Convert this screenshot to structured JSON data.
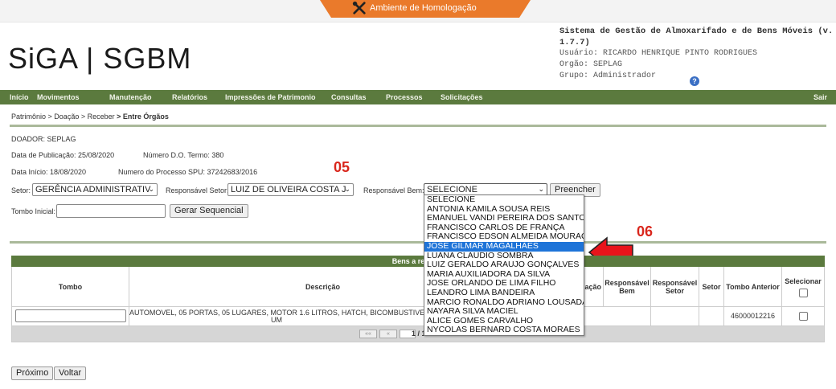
{
  "env_banner": {
    "label": "Ambiente de Homologação",
    "icon": "tools-icon",
    "color": "#ea7a2b"
  },
  "logo": {
    "text": "SiGA | SGBM"
  },
  "system": {
    "title": "Sistema de Gestão de Almoxarifado e de Bens Móveis (v. 1.7.7)",
    "user": "Usuário: RICARDO HENRIQUE PINTO RODRIGUES",
    "org": "Orgão: SEPLAG",
    "group": "Grupo: Administrador",
    "help_icon": "?"
  },
  "menu": {
    "items": [
      "Início",
      "Movimentos",
      "Manutenção",
      "Relatórios",
      "Impressões de Patrimonio",
      "Consultas",
      "Processos",
      "Solicitações"
    ],
    "logout": "Sair",
    "color": "#5b7a3e"
  },
  "breadcrumb": {
    "parts": [
      "Patrimônio",
      "> Doação",
      "> Receber",
      "> Entre Órgãos"
    ]
  },
  "info": {
    "donor": "DOADOR: SEPLAG",
    "pub_date": "Data de Publicação: 25/08/2020",
    "do_term": "Número D.O. Termo: 380",
    "start_date": "Data Início: 18/08/2020",
    "process": "Numero do Processo SPU: 37242683/2016"
  },
  "annotations": {
    "step_a": "05",
    "step_b": "06",
    "color": "#d9261c"
  },
  "form": {
    "setor_label": "Setor:",
    "setor_value": "GERÊNCIA ADMINISTRATIV",
    "resp_setor_label": "Responsável Setor:",
    "resp_setor_value": "LUIZ DE OLIVEIRA COSTA J",
    "resp_bem_label": "Responsável Bem:",
    "resp_bem_value": "SELECIONE",
    "fill_button": "Preencher",
    "tombo_label": "Tombo Inicial:",
    "tombo_value": "",
    "sequence_button": "Gerar Sequencial"
  },
  "dropdown": {
    "options": [
      "SELECIONE",
      "ANTONIA KAMILA SOUSA REIS",
      "EMANUEL VANDI PEREIRA DOS SANTOS",
      "FRANCISCO CARLOS DE FRANÇA",
      "FRANCISCO EDSON ALMEIDA MOURÃO",
      "JOSE GILMAR MAGALHÃES",
      "LUANA CLAUDIO SOMBRA",
      "LUIZ GERALDO ARAUJO GONÇALVES",
      "MARIA AUXILIADORA DA SILVA",
      "JOSÉ ORLANDO DE LIMA FILHO",
      "LEANDRO LIMA BANDEIRA",
      "MARCIO RONALDO ADRIANO LOUSADA",
      "NAYARA SILVA MACIEL",
      "ALICE GOMES CARVALHO",
      "NYCOLAS BERNARD COSTA MORAES"
    ],
    "highlighted": "JOSE GILMAR MAGALHÃES"
  },
  "grid": {
    "title": "Bens a receber",
    "columns": {
      "tombo": "Tombo",
      "descricao": "Descrição",
      "situacao": "ação",
      "resp_bem": "Responsável Bem",
      "resp_setor": "Responsável Setor",
      "setor": "Setor",
      "tombo_anterior": "Tombo Anterior",
      "selecionar": "Selecionar"
    },
    "rows": [
      {
        "tombo": "",
        "descricao_l1": "AUTOMOVEL, 05 PORTAS, 05 LUGARES, MOTOR 1.6 LITROS, HATCH, BICOMBUSTIVEL, 5",
        "descricao_l2": "UM",
        "tombo_anterior": "46000012216"
      }
    ],
    "pager": {
      "first": "««",
      "prev": "«",
      "page": "1 / 1"
    }
  },
  "footer": {
    "next_button": "Próximo",
    "back_button": "Voltar"
  }
}
